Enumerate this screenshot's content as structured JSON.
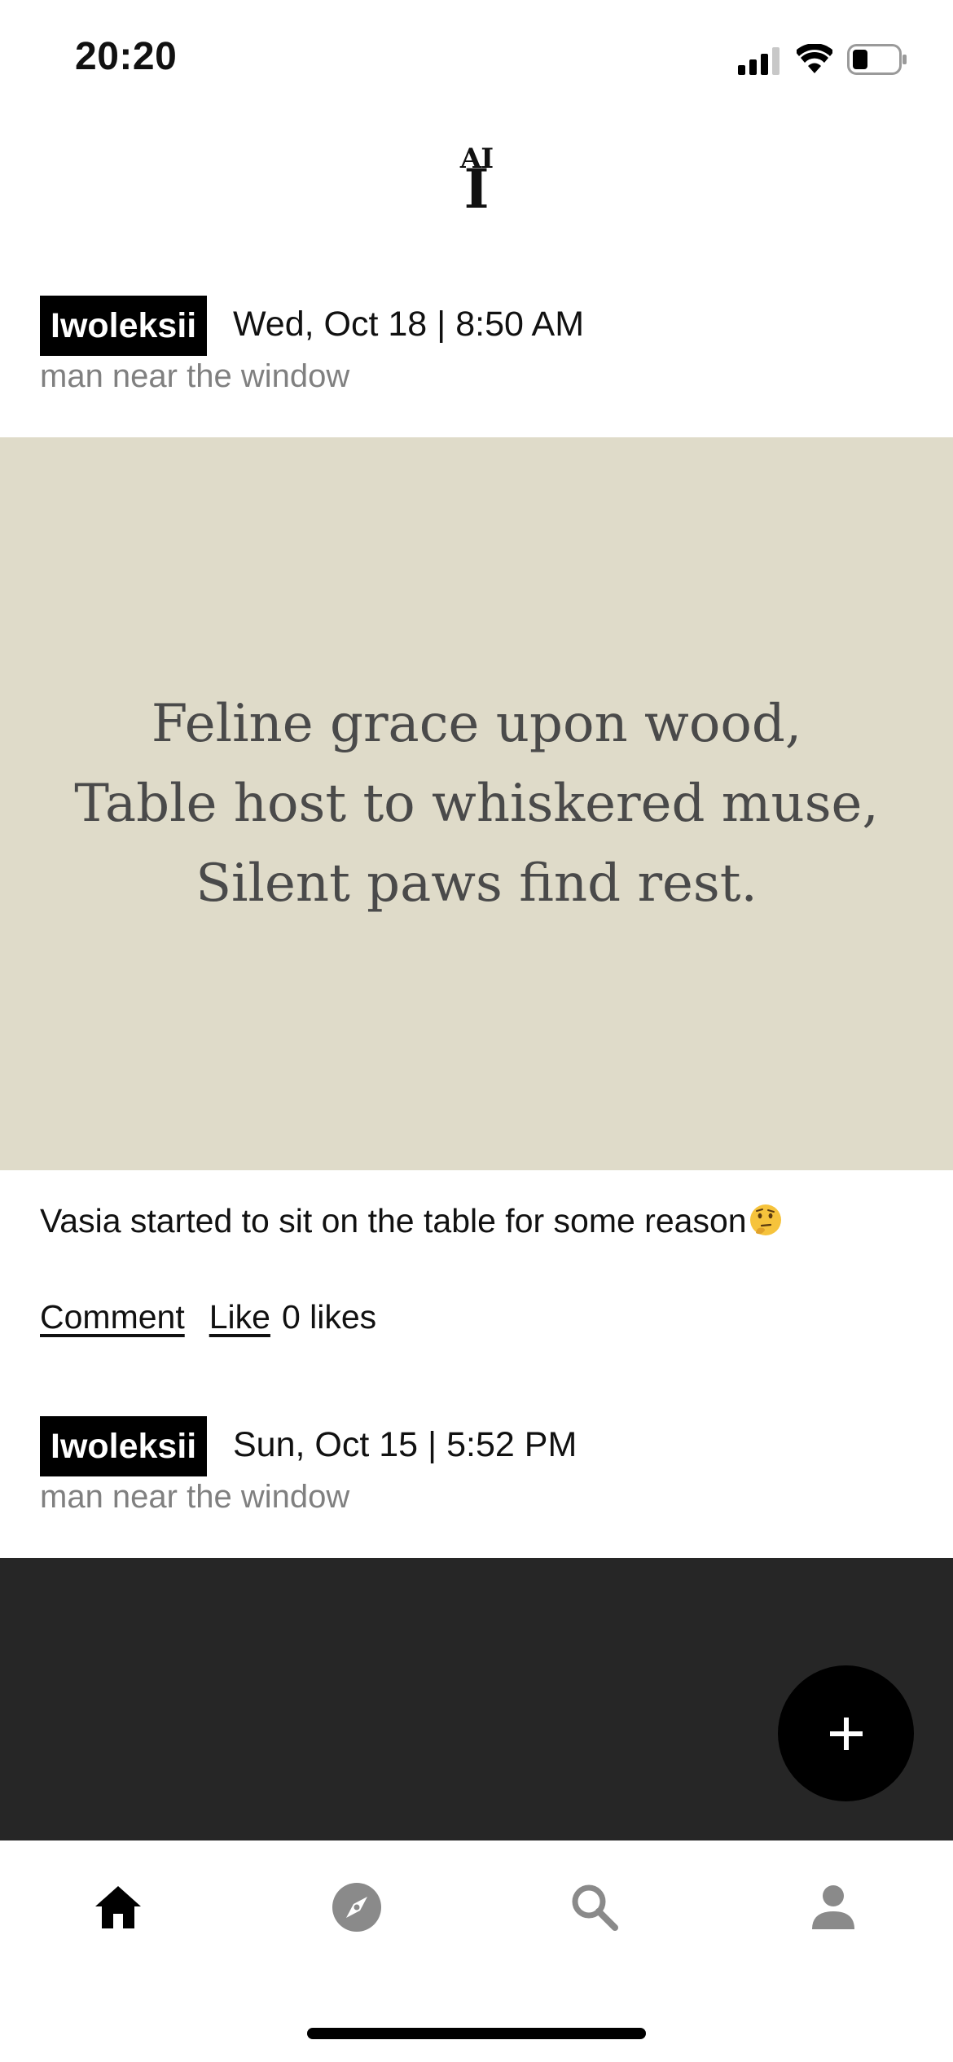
{
  "status_bar": {
    "time": "20:20"
  },
  "app": {
    "logo_top": "AI",
    "logo_bottom": "I"
  },
  "posts": [
    {
      "username": "Iwoleksii",
      "date": "Wed, Oct 18 | 8:50 AM",
      "subtitle": "man near the window",
      "haiku": [
        "Feline grace upon wood,",
        "Table host to whiskered muse,",
        "Silent paws find rest."
      ],
      "caption": "Vasia started to sit on the table for some reason",
      "caption_emoji": "thinking-face-icon",
      "comment_label": "Comment",
      "like_label": "Like",
      "likes_text": "0 likes"
    },
    {
      "username": "Iwoleksii",
      "date": "Sun, Oct 15 | 5:52 PM",
      "subtitle": "man near the window"
    }
  ],
  "fab": {
    "icon": "plus-icon"
  },
  "nav": [
    {
      "icon": "home-icon",
      "active": true
    },
    {
      "icon": "compass-icon",
      "active": false
    },
    {
      "icon": "search-icon",
      "active": false
    },
    {
      "icon": "profile-icon",
      "active": false
    }
  ],
  "colors": {
    "haiku_bg": "#dfdbc9",
    "dark_block": "#262626",
    "badge": "#000000",
    "muted": "#808080",
    "inactive_icon": "#8a8a8a"
  }
}
